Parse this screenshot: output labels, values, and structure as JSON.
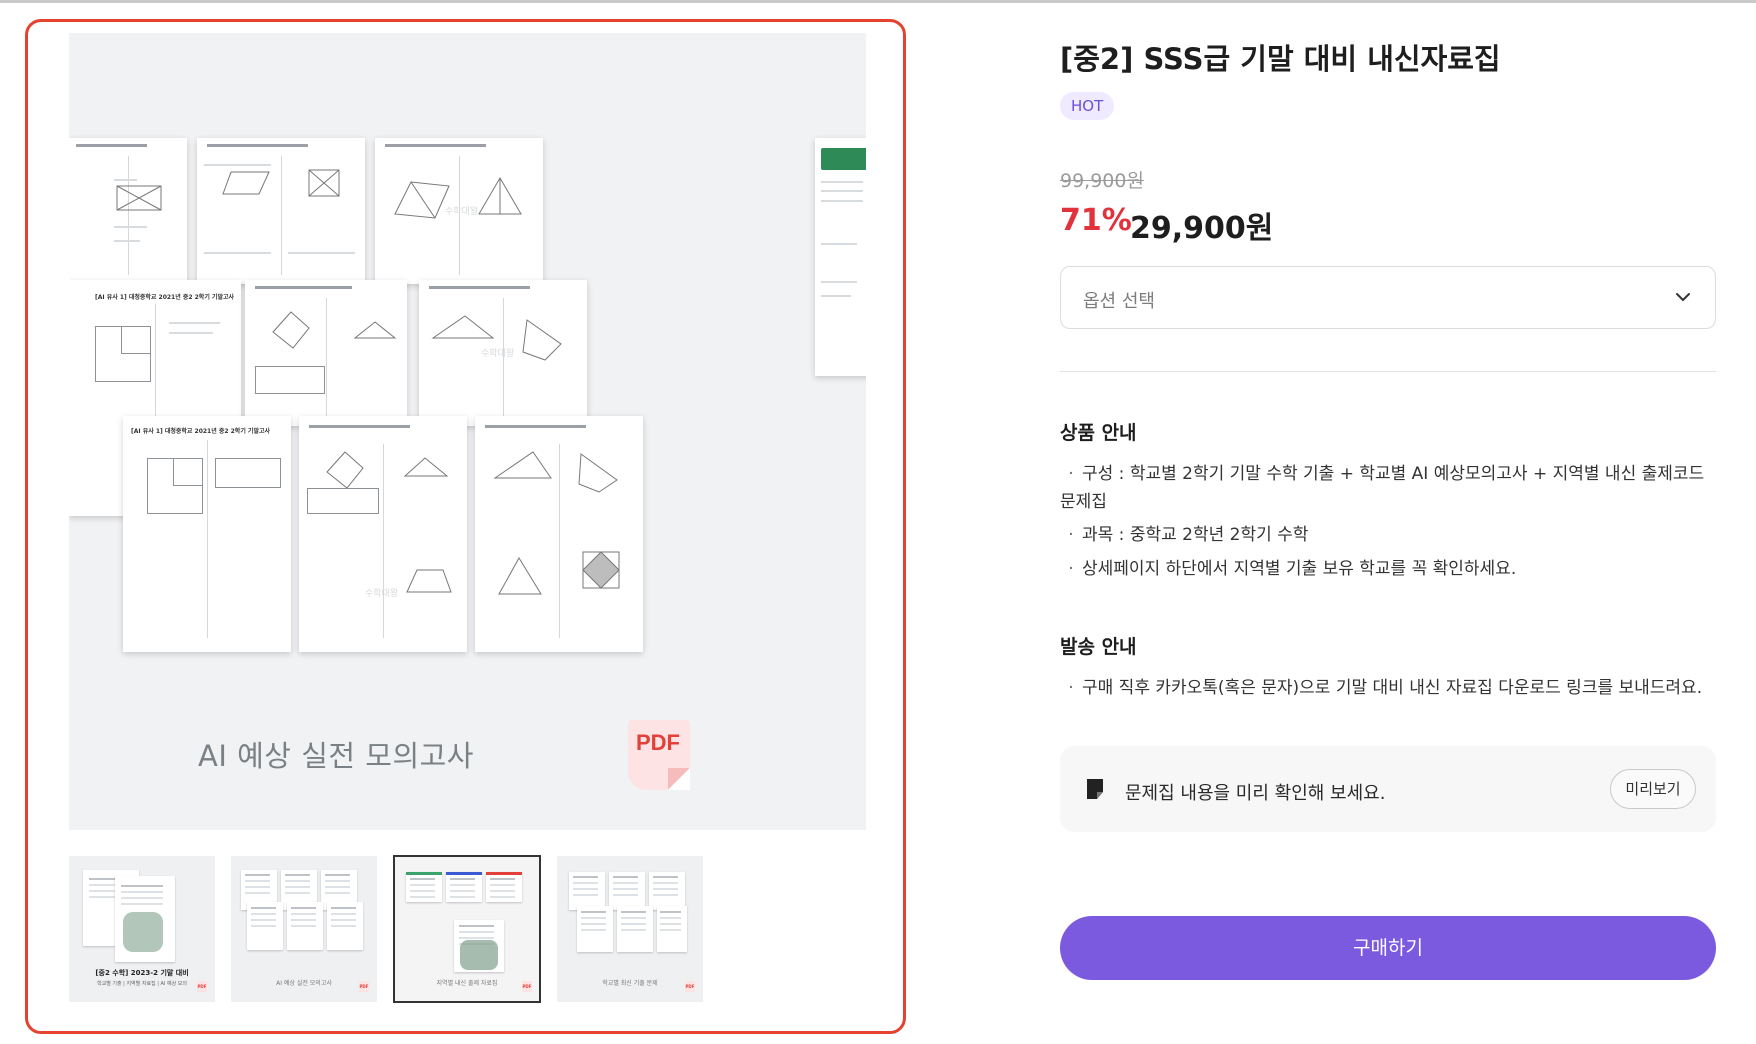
{
  "gallery": {
    "main_caption": "AI 예상 실전 모의고사",
    "pdf_label": "PDF",
    "sheet_title_1": "[AI 유사 1] 대청중학교 2021년 중2 2학기 기말고사",
    "sheet_title_2": "[AI 유사 1] 대청중학교 2021년 중2 2학기 기말고사",
    "sheet_title_3": "...[중학교 2021년 중2 2학기 기말고사",
    "thumbnails": [
      {
        "caption_bold": "[중2 수학] 2023-2 기말 대비",
        "caption_sub": "학교별 기출 | 지역별 자료집 | AI 예상 모의"
      },
      {
        "caption": "AI 예상 실전 모의고사"
      },
      {
        "caption": "지역별 내신 출제 자료집"
      },
      {
        "caption": "학교별 최신 기출 문제"
      }
    ]
  },
  "product": {
    "title": "[중2] SSS급 기말 대비 내신자료집",
    "badge": "HOT",
    "original_price": "99,900원",
    "discount_rate": "71%",
    "sale_price": "29,900원",
    "option_placeholder": "옵션 선택"
  },
  "product_info": {
    "heading": "상품 안내",
    "items": [
      "구성 : 학교별 2학기 기말 수학 기출 + 학교별 AI 예상모의고사 + 지역별 내신 출제코드",
      "문제집",
      "과목 : 중학교 2학년 2학기 수학",
      "상세페이지 하단에서 지역별 기출 보유 학교를 꼭 확인하세요."
    ]
  },
  "shipping_info": {
    "heading": "발송 안내",
    "items": [
      "구매 직후 카카오톡(혹은 문자)으로 기말 대비 내신 자료집 다운로드 링크를 보내드려요."
    ]
  },
  "preview": {
    "text": "문제집 내용을 미리 확인해 보세요.",
    "button": "미리보기"
  },
  "buy_button": "구매하기",
  "colors": {
    "accent": "#7b5ae0",
    "discount": "#e2333d",
    "frame": "#e5432f",
    "badge_bg": "#efeaff"
  }
}
